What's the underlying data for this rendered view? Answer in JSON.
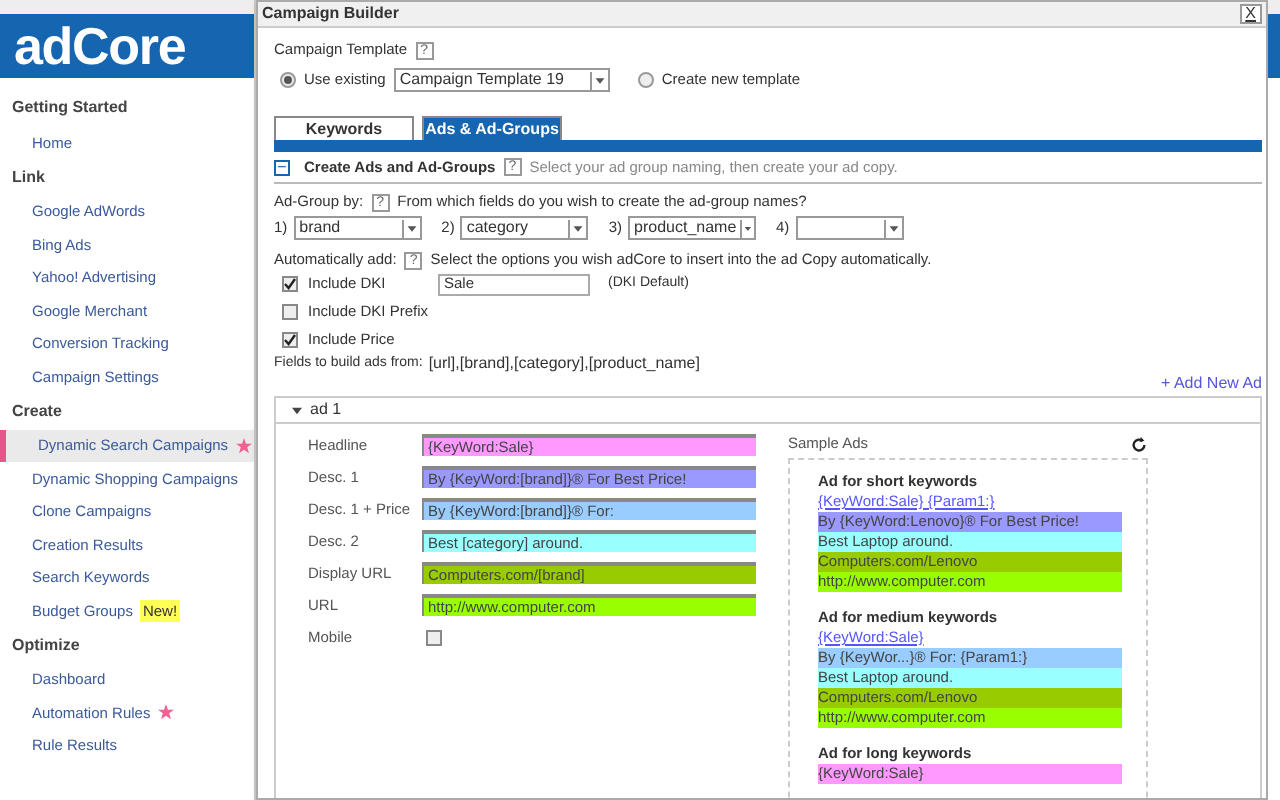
{
  "logo": "adCore",
  "sidebar": [
    {
      "heading": "Getting Started",
      "items": [
        {
          "label": "Home",
          "selected": false,
          "starred": false
        }
      ]
    },
    {
      "heading": "Link",
      "items": [
        {
          "label": "Google AdWords",
          "selected": false,
          "starred": false
        },
        {
          "label": "Bing Ads",
          "selected": false,
          "starred": false
        },
        {
          "label": "Yahoo! Advertising",
          "selected": false,
          "starred": false
        },
        {
          "label": "Google Merchant",
          "selected": false,
          "starred": false
        },
        {
          "label": "Conversion Tracking",
          "selected": false,
          "starred": false
        },
        {
          "label": "Campaign Settings",
          "selected": false,
          "starred": false
        }
      ]
    },
    {
      "heading": "Create",
      "items": [
        {
          "label": "Dynamic Search Campaigns",
          "selected": true,
          "starred": true
        },
        {
          "label": "Dynamic Shopping Campaigns",
          "selected": false,
          "starred": false
        },
        {
          "label": "Clone Campaigns",
          "selected": false,
          "starred": false
        },
        {
          "label": "Creation Results",
          "selected": false,
          "starred": false
        },
        {
          "label": "Search Keywords",
          "selected": false,
          "starred": false
        },
        {
          "label": "Budget Groups",
          "selected": false,
          "starred": false,
          "badge": "New!"
        }
      ]
    },
    {
      "heading": "Optimize",
      "items": [
        {
          "label": "Dashboard",
          "selected": false,
          "starred": false
        },
        {
          "label": "Automation Rules",
          "selected": false,
          "starred": true
        },
        {
          "label": "Rule Results",
          "selected": false,
          "starred": false
        }
      ]
    }
  ],
  "dialog": {
    "title": "Campaign Builder",
    "close": "X",
    "template": {
      "label": "Campaign Template",
      "help": "?",
      "options": [
        {
          "label": "Use existing",
          "selected": true,
          "value": "Campaign Template 19"
        },
        {
          "label": "Create new template",
          "selected": false
        }
      ]
    },
    "tabs": [
      {
        "label": "Keywords",
        "selected": false
      },
      {
        "label": "Ads & Ad-Groups",
        "selected": true
      }
    ],
    "section": {
      "toggle": "−",
      "title": "Create Ads and Ad-Groups",
      "help": "?",
      "hint": "Select your ad group naming, then create your ad copy."
    },
    "ad_group": {
      "label": "Ad-Group by:",
      "help": "?",
      "hint": "From which fields do you wish to create the ad-group names?",
      "selects": [
        {
          "number": "1)",
          "value": "brand"
        },
        {
          "number": "2)",
          "value": "category"
        },
        {
          "number": "3)",
          "value": "product_name"
        },
        {
          "number": "4)"
        }
      ]
    },
    "auto_add": {
      "label": "Automatically add:",
      "help": "?",
      "hint": "Select the options you wish adCore to insert into the ad Copy automatically."
    },
    "options": [
      {
        "label": "Include DKI",
        "checked": true,
        "value": "Sale",
        "note": "(DKI Default)"
      },
      {
        "label": "Include DKI Prefix",
        "checked": false
      },
      {
        "label": "Include Price",
        "checked": true
      }
    ],
    "fields_label": "Fields to build ads from:",
    "fields": "[url],[brand],[category],[product_name]",
    "add_ad": "+ Add New Ad",
    "ad": {
      "title": "ad 1",
      "expanded": true,
      "rows": [
        {
          "kind": "text",
          "label": "Headline",
          "value": "{KeyWord:Sale}",
          "color": "#ff99ff"
        },
        {
          "kind": "text",
          "label": "Desc. 1",
          "value": "By {KeyWord:[brand]}® For Best Price!",
          "color": "#9999ff"
        },
        {
          "kind": "text",
          "label": "Desc. 1 + Price",
          "value": "By {KeyWord:[brand]}® For:",
          "color": "#99ccff"
        },
        {
          "kind": "text",
          "label": "Desc. 2",
          "value": "Best [category] around.",
          "color": "#99ffff"
        },
        {
          "kind": "text",
          "label": "Display URL",
          "value": "Computers.com/[brand]",
          "color": "#99cc00"
        },
        {
          "kind": "text",
          "label": "URL",
          "value": "http://www.computer.com",
          "color": "#99ff00"
        },
        {
          "kind": "checkbox",
          "label": "Mobile",
          "checked": false
        }
      ],
      "samples_title": "Sample Ads",
      "samples": [
        {
          "title": "Ad for short keywords",
          "lines": [
            {
              "kind": "link",
              "text": "{KeyWord:Sale} {Param1:}"
            },
            {
              "kind": "fill",
              "text": "By {KeyWord:Lenovo}® For Best Price!",
              "color": "#9999ff"
            },
            {
              "kind": "fill",
              "text": "Best Laptop around.",
              "color": "#99ffff"
            },
            {
              "kind": "fill",
              "text": "Computers.com/Lenovo",
              "color": "#99cc00"
            },
            {
              "kind": "fill",
              "text": "http://www.computer.com",
              "color": "#99ff00"
            }
          ]
        },
        {
          "title": "Ad for medium keywords",
          "lines": [
            {
              "kind": "link",
              "text": "{KeyWord:Sale}"
            },
            {
              "kind": "fill",
              "text": "By {KeyWor...}® For: {Param1:}",
              "color": "#99ccff"
            },
            {
              "kind": "fill",
              "text": "Best Laptop around.",
              "color": "#99ffff"
            },
            {
              "kind": "fill",
              "text": "Computers.com/Lenovo",
              "color": "#99cc00"
            },
            {
              "kind": "fill",
              "text": "http://www.computer.com",
              "color": "#99ff00"
            }
          ]
        },
        {
          "title": "Ad for long keywords",
          "lines": [
            {
              "kind": "fill",
              "text": "{KeyWord:Sale}",
              "color": "#ff99ff"
            }
          ]
        }
      ]
    }
  }
}
